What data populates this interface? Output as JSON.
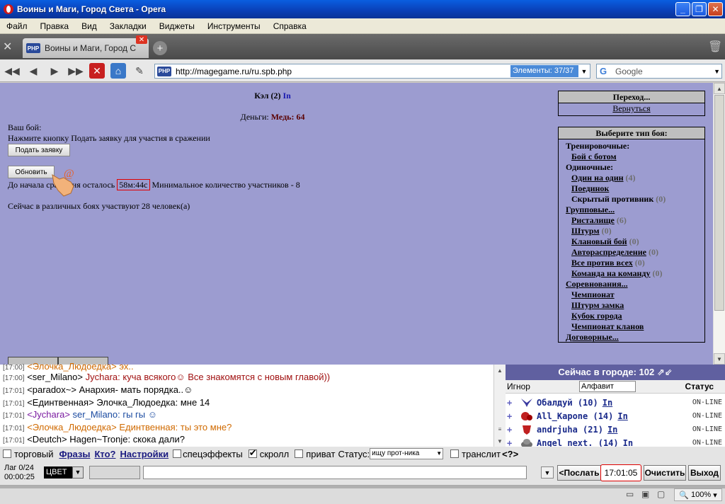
{
  "window": {
    "title": "Воины и Маги, Город Света - Opera"
  },
  "menu": [
    "Файл",
    "Правка",
    "Вид",
    "Закладки",
    "Виджеты",
    "Инструменты",
    "Справка"
  ],
  "tab": {
    "title": "Воины и Маги, Город С...",
    "favicon": "PHP"
  },
  "address": {
    "url": "http://magegame.ru/ru.spb.php",
    "elements": "Элементы:  37/37",
    "search_placeholder": "Google"
  },
  "page": {
    "hero_name": "Кэл (2)",
    "hero_link": "In",
    "money_label": "Деньги:",
    "money_value": "Медь: 64",
    "your_fight": "Ваш бой:",
    "instruction": "Нажмите кнопку Подать заявку для участия в сражении",
    "apply_button": "Подать заявку",
    "refresh_button": "Обновить",
    "countdown_prefix": "До начала сражения осталось",
    "countdown_value": "58м:44с",
    "countdown_suffix": "Минимальное количество участников - 8",
    "participants": "Сейчас в различных боях участвуют 28 человек(а)"
  },
  "transition_panel": {
    "header": "Переход...",
    "back": "Вернуться"
  },
  "fight_types": {
    "header": "Выберите тип боя:",
    "training": "Тренировочные:",
    "bot": "Бой с ботом",
    "single": "Одиночные:",
    "one_on_one": "Один на один",
    "one_on_one_count": "(4)",
    "duel": "Поединок",
    "hidden": "Скрытый противник",
    "hidden_count": "(0)",
    "group": "Групповые...",
    "arena": "Ристалище",
    "arena_count": "(6)",
    "storm": "Штурм",
    "storm_count": "(0)",
    "clan": "Клановый бой",
    "clan_count": "(0)",
    "auto": "Автораспределение",
    "auto_count": "(0)",
    "all_vs_all": "Все против всех",
    "all_vs_all_count": "(0)",
    "team": "Команда на команду",
    "team_count": "(0)",
    "competitions": "Соревнования...",
    "championship": "Чемпионат",
    "castle": "Штурм замка",
    "cup": "Кубок города",
    "clan_champ": "Чемпионат кланов",
    "contract": "Договорные..."
  },
  "chat": {
    "lines": [
      {
        "time": "[17:00]",
        "nick": "<Элочка_Людоедка>",
        "msg": "эх..",
        "nick_color": "#d06a00",
        "msg_color": "#d06a00"
      },
      {
        "time": "[17:00]",
        "nick": "<ser_Milano>",
        "msg": "Jychara: куча всякого☺ Все знакомятся с новым главой))",
        "nick_color": "#000000",
        "msg_color": "#a01010"
      },
      {
        "time": "[17:01]",
        "nick": "<paradox~>",
        "msg": "Анархия- мать порядка..☺",
        "nick_color": "#000000",
        "msg_color": "#000000"
      },
      {
        "time": "[17:01]",
        "nick": "<Единтвенная>",
        "msg": "Элочка_Людоедка: мне 14",
        "nick_color": "#000000",
        "msg_color": "#000000"
      },
      {
        "time": "[17:01]",
        "nick": "<Jychara>",
        "msg": "ser_Milano: гы гы ☺",
        "nick_color": "#7a1aa0",
        "msg_color": "#1a4aa0"
      },
      {
        "time": "[17:01]",
        "nick": "<Элочка_Людоедка>",
        "msg": "Единтвенная: ты это мне?",
        "nick_color": "#d06a00",
        "msg_color": "#d06a00"
      },
      {
        "time": "[17:01]",
        "nick": "<Deutch>",
        "msg": "Hagen~Tronje: скока дали?",
        "nick_color": "#000000",
        "msg_color": "#000000"
      }
    ]
  },
  "users": {
    "header": "Сейчас в городе: 102",
    "ignore": "Игнор",
    "sort": "Алфавит",
    "status": "Статус",
    "list": [
      {
        "plus": "+",
        "name": "Обалдуй",
        "level": "(10)",
        "link": "In",
        "status": "ON-LINE"
      },
      {
        "plus": "+",
        "name": "All_Kapone",
        "level": "(14)",
        "link": "In",
        "status": "ON-LINE"
      },
      {
        "plus": "+",
        "name": "andrjuha",
        "level": "(21)",
        "link": "In",
        "status": "ON-LINE"
      },
      {
        "plus": "+",
        "name": "Angel_next.",
        "level": "(14)",
        "link": "In",
        "status": "ON-LINE"
      }
    ]
  },
  "controls": {
    "trade": "торговый",
    "phrases": "Фразы",
    "who": "Кто?",
    "settings": "Настройки",
    "effects": "спецэффекты",
    "scroll": "скролл",
    "private": "приват",
    "status_label": "Статус:",
    "status_value": "ищу прот-ника",
    "translit": "транслит",
    "help": "<?>"
  },
  "input": {
    "lag": "Лаг 0/24",
    "elapsed": "00:00:25",
    "color": "ЦВЕТ",
    "send": "<Послать",
    "clock": "17:01:05",
    "clear": "Очистить",
    "exit": "Выход"
  },
  "status": {
    "zoom": "100%"
  }
}
